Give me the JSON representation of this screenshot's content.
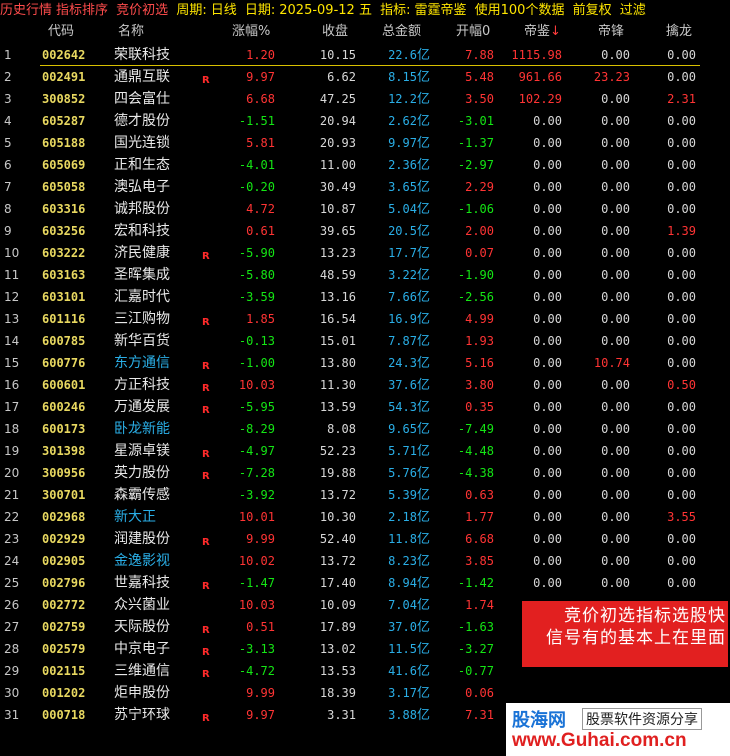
{
  "title_bar": {
    "history": "历史行情",
    "sort": "指标排序",
    "strategy": "竞价初选",
    "period_label": "周期:",
    "period_value": "日线",
    "date_label": "日期:",
    "date_value": "2025-09-12 五",
    "indicator_label": "指标:",
    "indicator_value": "雷霆帝鉴",
    "use_label": "使用100个数据",
    "adjust": "前复权",
    "filter": "过滤"
  },
  "columns": {
    "code": "代码",
    "name": "名称",
    "change": "涨幅%",
    "close": "收盘",
    "amount": "总金额",
    "open": "开幅0",
    "emperor": "帝鉴",
    "sort_arrow": "↓",
    "feng": "帝锋",
    "dragon": "擒龙"
  },
  "rows": [
    {
      "idx": "1",
      "code": "002642",
      "name": "荣联科技",
      "name_blue": false,
      "flag": "",
      "change": "1.20",
      "change_color": "red",
      "close": "10.15",
      "amount": "22.6",
      "unit": "亿",
      "open": "7.88",
      "open_color": "red",
      "emperor": "1115.98",
      "emperor_color": "red",
      "feng": "0.00",
      "feng_color": "white",
      "dragon": "0.00",
      "dragon_color": "white"
    },
    {
      "idx": "2",
      "code": "002491",
      "name": "通鼎互联",
      "name_blue": false,
      "flag": "R",
      "change": "9.97",
      "change_color": "red",
      "close": "6.62",
      "amount": "8.15",
      "unit": "亿",
      "open": "5.48",
      "open_color": "red",
      "emperor": "961.66",
      "emperor_color": "red",
      "feng": "23.23",
      "feng_color": "red",
      "dragon": "0.00",
      "dragon_color": "white"
    },
    {
      "idx": "3",
      "code": "300852",
      "name": "四会富仕",
      "name_blue": false,
      "flag": "",
      "change": "6.68",
      "change_color": "red",
      "close": "47.25",
      "amount": "12.2",
      "unit": "亿",
      "open": "3.50",
      "open_color": "red",
      "emperor": "102.29",
      "emperor_color": "red",
      "feng": "0.00",
      "feng_color": "white",
      "dragon": "2.31",
      "dragon_color": "red"
    },
    {
      "idx": "4",
      "code": "605287",
      "name": "德才股份",
      "name_blue": false,
      "flag": "",
      "change": "-1.51",
      "change_color": "green",
      "close": "20.94",
      "amount": "2.62",
      "unit": "亿",
      "open": "-3.01",
      "open_color": "green",
      "emperor": "0.00",
      "emperor_color": "white",
      "feng": "0.00",
      "feng_color": "white",
      "dragon": "0.00",
      "dragon_color": "white"
    },
    {
      "idx": "5",
      "code": "605188",
      "name": "国光连锁",
      "name_blue": false,
      "flag": "",
      "change": "5.81",
      "change_color": "red",
      "close": "20.93",
      "amount": "9.97",
      "unit": "亿",
      "open": "-1.37",
      "open_color": "green",
      "emperor": "0.00",
      "emperor_color": "white",
      "feng": "0.00",
      "feng_color": "white",
      "dragon": "0.00",
      "dragon_color": "white"
    },
    {
      "idx": "6",
      "code": "605069",
      "name": "正和生态",
      "name_blue": false,
      "flag": "",
      "change": "-4.01",
      "change_color": "green",
      "close": "11.00",
      "amount": "2.36",
      "unit": "亿",
      "open": "-2.97",
      "open_color": "green",
      "emperor": "0.00",
      "emperor_color": "white",
      "feng": "0.00",
      "feng_color": "white",
      "dragon": "0.00",
      "dragon_color": "white"
    },
    {
      "idx": "7",
      "code": "605058",
      "name": "澳弘电子",
      "name_blue": false,
      "flag": "",
      "change": "-0.20",
      "change_color": "green",
      "close": "30.49",
      "amount": "3.65",
      "unit": "亿",
      "open": "2.29",
      "open_color": "red",
      "emperor": "0.00",
      "emperor_color": "white",
      "feng": "0.00",
      "feng_color": "white",
      "dragon": "0.00",
      "dragon_color": "white"
    },
    {
      "idx": "8",
      "code": "603316",
      "name": "诚邦股份",
      "name_blue": false,
      "flag": "",
      "change": "4.72",
      "change_color": "red",
      "close": "10.87",
      "amount": "5.04",
      "unit": "亿",
      "open": "-1.06",
      "open_color": "green",
      "emperor": "0.00",
      "emperor_color": "white",
      "feng": "0.00",
      "feng_color": "white",
      "dragon": "0.00",
      "dragon_color": "white"
    },
    {
      "idx": "9",
      "code": "603256",
      "name": "宏和科技",
      "name_blue": false,
      "flag": "",
      "change": "0.61",
      "change_color": "red",
      "close": "39.65",
      "amount": "20.5",
      "unit": "亿",
      "open": "2.00",
      "open_color": "red",
      "emperor": "0.00",
      "emperor_color": "white",
      "feng": "0.00",
      "feng_color": "white",
      "dragon": "1.39",
      "dragon_color": "red"
    },
    {
      "idx": "10",
      "code": "603222",
      "name": "济民健康",
      "name_blue": false,
      "flag": "R",
      "change": "-5.90",
      "change_color": "green",
      "close": "13.23",
      "amount": "17.7",
      "unit": "亿",
      "open": "0.07",
      "open_color": "red",
      "emperor": "0.00",
      "emperor_color": "white",
      "feng": "0.00",
      "feng_color": "white",
      "dragon": "0.00",
      "dragon_color": "white"
    },
    {
      "idx": "11",
      "code": "603163",
      "name": "圣晖集成",
      "name_blue": false,
      "flag": "",
      "change": "-5.80",
      "change_color": "green",
      "close": "48.59",
      "amount": "3.22",
      "unit": "亿",
      "open": "-1.90",
      "open_color": "green",
      "emperor": "0.00",
      "emperor_color": "white",
      "feng": "0.00",
      "feng_color": "white",
      "dragon": "0.00",
      "dragon_color": "white"
    },
    {
      "idx": "12",
      "code": "603101",
      "name": "汇嘉时代",
      "name_blue": false,
      "flag": "",
      "change": "-3.59",
      "change_color": "green",
      "close": "13.16",
      "amount": "7.66",
      "unit": "亿",
      "open": "-2.56",
      "open_color": "green",
      "emperor": "0.00",
      "emperor_color": "white",
      "feng": "0.00",
      "feng_color": "white",
      "dragon": "0.00",
      "dragon_color": "white"
    },
    {
      "idx": "13",
      "code": "601116",
      "name": "三江购物",
      "name_blue": false,
      "flag": "R",
      "change": "1.85",
      "change_color": "red",
      "close": "16.54",
      "amount": "16.9",
      "unit": "亿",
      "open": "4.99",
      "open_color": "red",
      "emperor": "0.00",
      "emperor_color": "white",
      "feng": "0.00",
      "feng_color": "white",
      "dragon": "0.00",
      "dragon_color": "white"
    },
    {
      "idx": "14",
      "code": "600785",
      "name": "新华百货",
      "name_blue": false,
      "flag": "",
      "change": "-0.13",
      "change_color": "green",
      "close": "15.01",
      "amount": "7.87",
      "unit": "亿",
      "open": "1.93",
      "open_color": "red",
      "emperor": "0.00",
      "emperor_color": "white",
      "feng": "0.00",
      "feng_color": "white",
      "dragon": "0.00",
      "dragon_color": "white"
    },
    {
      "idx": "15",
      "code": "600776",
      "name": "东方通信",
      "name_blue": true,
      "flag": "R",
      "change": "-1.00",
      "change_color": "green",
      "close": "13.80",
      "amount": "24.3",
      "unit": "亿",
      "open": "5.16",
      "open_color": "red",
      "emperor": "0.00",
      "emperor_color": "white",
      "feng": "10.74",
      "feng_color": "red",
      "dragon": "0.00",
      "dragon_color": "white"
    },
    {
      "idx": "16",
      "code": "600601",
      "name": "方正科技",
      "name_blue": false,
      "flag": "R",
      "change": "10.03",
      "change_color": "red",
      "close": "11.30",
      "amount": "37.6",
      "unit": "亿",
      "open": "3.80",
      "open_color": "red",
      "emperor": "0.00",
      "emperor_color": "white",
      "feng": "0.00",
      "feng_color": "white",
      "dragon": "0.50",
      "dragon_color": "red"
    },
    {
      "idx": "17",
      "code": "600246",
      "name": "万通发展",
      "name_blue": false,
      "flag": "R",
      "change": "-5.95",
      "change_color": "green",
      "close": "13.59",
      "amount": "54.3",
      "unit": "亿",
      "open": "0.35",
      "open_color": "red",
      "emperor": "0.00",
      "emperor_color": "white",
      "feng": "0.00",
      "feng_color": "white",
      "dragon": "0.00",
      "dragon_color": "white"
    },
    {
      "idx": "18",
      "code": "600173",
      "name": "卧龙新能",
      "name_blue": true,
      "flag": "",
      "change": "-8.29",
      "change_color": "green",
      "close": "8.08",
      "amount": "9.65",
      "unit": "亿",
      "open": "-7.49",
      "open_color": "green",
      "emperor": "0.00",
      "emperor_color": "white",
      "feng": "0.00",
      "feng_color": "white",
      "dragon": "0.00",
      "dragon_color": "white"
    },
    {
      "idx": "19",
      "code": "301398",
      "name": "星源卓镁",
      "name_blue": false,
      "flag": "R",
      "change": "-4.97",
      "change_color": "green",
      "close": "52.23",
      "amount": "5.71",
      "unit": "亿",
      "open": "-4.48",
      "open_color": "green",
      "emperor": "0.00",
      "emperor_color": "white",
      "feng": "0.00",
      "feng_color": "white",
      "dragon": "0.00",
      "dragon_color": "white"
    },
    {
      "idx": "20",
      "code": "300956",
      "name": "英力股份",
      "name_blue": false,
      "flag": "R",
      "change": "-7.28",
      "change_color": "green",
      "close": "19.88",
      "amount": "5.76",
      "unit": "亿",
      "open": "-4.38",
      "open_color": "green",
      "emperor": "0.00",
      "emperor_color": "white",
      "feng": "0.00",
      "feng_color": "white",
      "dragon": "0.00",
      "dragon_color": "white"
    },
    {
      "idx": "21",
      "code": "300701",
      "name": "森霸传感",
      "name_blue": false,
      "flag": "",
      "change": "-3.92",
      "change_color": "green",
      "close": "13.72",
      "amount": "5.39",
      "unit": "亿",
      "open": "0.63",
      "open_color": "red",
      "emperor": "0.00",
      "emperor_color": "white",
      "feng": "0.00",
      "feng_color": "white",
      "dragon": "0.00",
      "dragon_color": "white"
    },
    {
      "idx": "22",
      "code": "002968",
      "name": "新大正",
      "name_blue": true,
      "flag": "",
      "change": "10.01",
      "change_color": "red",
      "close": "10.30",
      "amount": "2.18",
      "unit": "亿",
      "open": "1.77",
      "open_color": "red",
      "emperor": "0.00",
      "emperor_color": "white",
      "feng": "0.00",
      "feng_color": "white",
      "dragon": "3.55",
      "dragon_color": "red"
    },
    {
      "idx": "23",
      "code": "002929",
      "name": "润建股份",
      "name_blue": false,
      "flag": "R",
      "change": "9.99",
      "change_color": "red",
      "close": "52.40",
      "amount": "11.8",
      "unit": "亿",
      "open": "6.68",
      "open_color": "red",
      "emperor": "0.00",
      "emperor_color": "white",
      "feng": "0.00",
      "feng_color": "white",
      "dragon": "0.00",
      "dragon_color": "white"
    },
    {
      "idx": "24",
      "code": "002905",
      "name": "金逸影视",
      "name_blue": true,
      "flag": "",
      "change": "10.02",
      "change_color": "red",
      "close": "13.72",
      "amount": "8.23",
      "unit": "亿",
      "open": "3.85",
      "open_color": "red",
      "emperor": "0.00",
      "emperor_color": "white",
      "feng": "0.00",
      "feng_color": "white",
      "dragon": "0.00",
      "dragon_color": "white"
    },
    {
      "idx": "25",
      "code": "002796",
      "name": "世嘉科技",
      "name_blue": false,
      "flag": "R",
      "change": "-1.47",
      "change_color": "green",
      "close": "17.40",
      "amount": "8.94",
      "unit": "亿",
      "open": "-1.42",
      "open_color": "green",
      "emperor": "0.00",
      "emperor_color": "white",
      "feng": "0.00",
      "feng_color": "white",
      "dragon": "0.00",
      "dragon_color": "white"
    },
    {
      "idx": "26",
      "code": "002772",
      "name": "众兴菌业",
      "name_blue": false,
      "flag": "",
      "change": "10.03",
      "change_color": "red",
      "close": "10.09",
      "amount": "7.04",
      "unit": "亿",
      "open": "1.74",
      "open_color": "red",
      "emperor": "",
      "emperor_color": "white",
      "feng": "",
      "feng_color": "white",
      "dragon": "",
      "dragon_color": "white"
    },
    {
      "idx": "27",
      "code": "002759",
      "name": "天际股份",
      "name_blue": false,
      "flag": "R",
      "change": "0.51",
      "change_color": "red",
      "close": "17.89",
      "amount": "37.0",
      "unit": "亿",
      "open": "-1.63",
      "open_color": "green",
      "emperor": "",
      "emperor_color": "white",
      "feng": "",
      "feng_color": "white",
      "dragon": "",
      "dragon_color": "white"
    },
    {
      "idx": "28",
      "code": "002579",
      "name": "中京电子",
      "name_blue": false,
      "flag": "R",
      "change": "-3.13",
      "change_color": "green",
      "close": "13.02",
      "amount": "11.5",
      "unit": "亿",
      "open": "-3.27",
      "open_color": "green",
      "emperor": "",
      "emperor_color": "white",
      "feng": "",
      "feng_color": "white",
      "dragon": "",
      "dragon_color": "white"
    },
    {
      "idx": "29",
      "code": "002115",
      "name": "三维通信",
      "name_blue": false,
      "flag": "R",
      "change": "-4.72",
      "change_color": "green",
      "close": "13.53",
      "amount": "41.6",
      "unit": "亿",
      "open": "-0.77",
      "open_color": "green",
      "emperor": "",
      "emperor_color": "white",
      "feng": "",
      "feng_color": "white",
      "dragon": "",
      "dragon_color": "white"
    },
    {
      "idx": "30",
      "code": "001202",
      "name": "炬申股份",
      "name_blue": false,
      "flag": "",
      "change": "9.99",
      "change_color": "red",
      "close": "18.39",
      "amount": "3.17",
      "unit": "亿",
      "open": "0.06",
      "open_color": "red",
      "emperor": "",
      "emperor_color": "white",
      "feng": "",
      "feng_color": "white",
      "dragon": "",
      "dragon_color": "white"
    },
    {
      "idx": "31",
      "code": "000718",
      "name": "苏宁环球",
      "name_blue": false,
      "flag": "R",
      "change": "9.97",
      "change_color": "red",
      "close": "3.31",
      "amount": "3.88",
      "unit": "亿",
      "open": "7.31",
      "open_color": "red",
      "emperor": "",
      "emperor_color": "white",
      "feng": "",
      "feng_color": "white",
      "dragon": "",
      "dragon_color": "white"
    }
  ],
  "overlay": {
    "line1": "竞价初选指标选股快",
    "line2": "信号有的基本上在里面"
  },
  "watermark": {
    "brand": "股海网",
    "sub": "股票软件资源分享",
    "url": "www.Guhai.com.cn"
  },
  "colors": {
    "red": "#ff3434",
    "green": "#14e614",
    "blue": "#2aaee6",
    "code": "#e8d860",
    "background": "#000000"
  }
}
